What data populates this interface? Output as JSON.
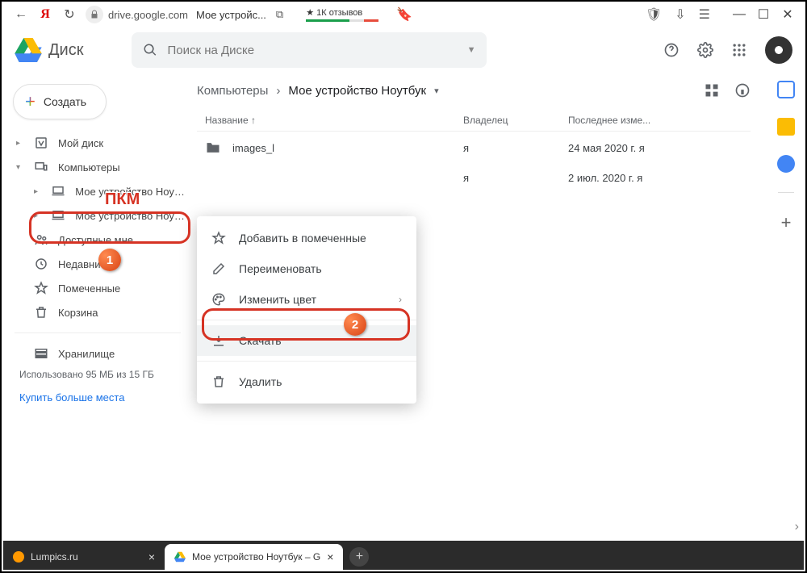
{
  "browser": {
    "domain": "drive.google.com",
    "page_title": "Мое устройс...",
    "rating": "★ 1К отзывов"
  },
  "drive": {
    "app_name": "Диск",
    "search_placeholder": "Поиск на Диске",
    "create_label": "Создать"
  },
  "sidebar": {
    "items": [
      {
        "label": "Мой диск"
      },
      {
        "label": "Компьютеры"
      },
      {
        "label": "Мое устройство Ноутбук"
      },
      {
        "label": "Мое устройство Ноутбук"
      },
      {
        "label": "Доступные мне"
      },
      {
        "label": "Недавние"
      },
      {
        "label": "Помеченные"
      },
      {
        "label": "Корзина"
      },
      {
        "label": "Хранилище"
      }
    ],
    "storage_used": "Использовано 95 МБ из 15 ГБ",
    "buy_more": "Купить больше места"
  },
  "breadcrumb": {
    "root": "Компьютеры",
    "current": "Мое устройство Ноутбук"
  },
  "columns": {
    "name": "Название",
    "owner": "Владелец",
    "modified": "Последнее изме..."
  },
  "rows": [
    {
      "name": "images_l",
      "owner": "я",
      "modified": "24 мая 2020 г.  я"
    },
    {
      "name": "",
      "owner": "я",
      "modified": "2 июл. 2020 г.  я"
    }
  ],
  "context_menu": {
    "star": "Добавить в помеченные",
    "rename": "Переименовать",
    "color": "Изменить цвет",
    "download": "Скачать",
    "delete": "Удалить"
  },
  "annotations": {
    "pkm": "ПКМ",
    "badge1": "1",
    "badge2": "2"
  },
  "tabs": {
    "tab1": "Lumpics.ru",
    "tab2": "Мое устройство Ноутбук – G"
  }
}
